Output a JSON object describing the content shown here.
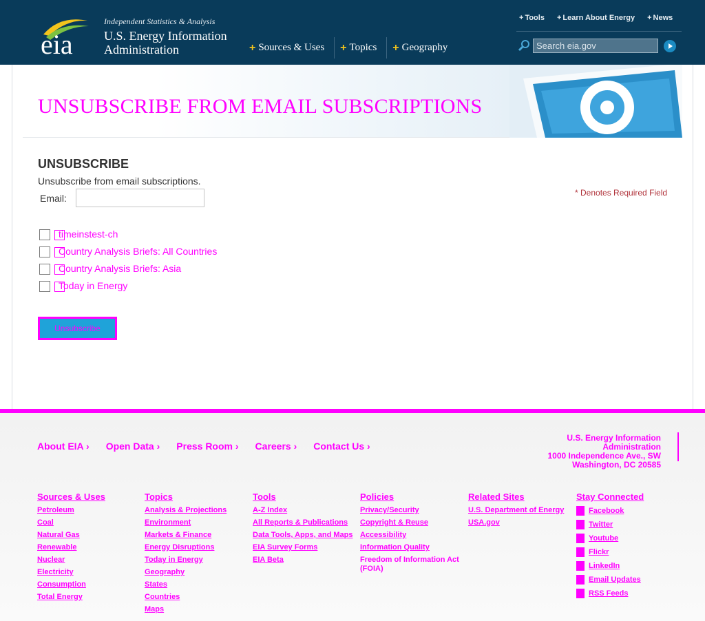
{
  "header": {
    "tagline": "Independent Statistics & Analysis",
    "site_name": "U.S. Energy Information Administration",
    "logo_text": "eia",
    "utility_links": [
      "Tools",
      "Learn About Energy",
      "News"
    ],
    "main_nav": [
      "Sources & Uses",
      "Topics",
      "Geography"
    ],
    "search_placeholder": "Search eia.gov"
  },
  "banner": {
    "title": "UNSUBSCRIBE FROM EMAIL SUBSCRIPTIONS"
  },
  "form": {
    "heading": "UNSUBSCRIBE",
    "description": "Unsubscribe from email subscriptions.",
    "required_note": "* Denotes Required Field",
    "email_label": "Email:",
    "email_value": "",
    "subscriptions": [
      {
        "label": "timeinstest-ch",
        "checked": false
      },
      {
        "label": "Country Analysis Briefs: All Countries",
        "checked": false
      },
      {
        "label": "Country Analysis Briefs: Asia",
        "checked": false
      },
      {
        "label": "Today in Energy",
        "checked": false
      }
    ],
    "submit_label": "Unsubscribe"
  },
  "footer": {
    "nav": [
      "About EIA",
      "Open Data",
      "Press Room",
      "Careers",
      "Contact Us"
    ],
    "address": [
      "U.S. Energy Information Administration",
      "1000 Independence Ave., SW",
      "Washington, DC 20585"
    ],
    "columns": [
      {
        "heading": "Sources & Uses",
        "links": [
          "Petroleum",
          "Coal",
          "Natural Gas",
          "Renewable",
          "Nuclear",
          "Electricity",
          "Consumption",
          "Total Energy"
        ]
      },
      {
        "heading": "Topics",
        "links": [
          "Analysis & Projections",
          "Environment",
          "Markets & Finance",
          "Energy Disruptions",
          "Today in Energy",
          "Geography",
          "States",
          "Countries",
          "Maps"
        ]
      },
      {
        "heading": "Tools",
        "links": [
          "A-Z Index",
          "All Reports & Publications",
          "Data Tools, Apps, and Maps",
          "EIA Survey Forms",
          "EIA Beta"
        ]
      },
      {
        "heading": "Policies",
        "links": [
          "Privacy/Security",
          "Copyright & Reuse",
          "Accessibility",
          "Information Quality",
          "Freedom of Information Act (FOIA)"
        ]
      },
      {
        "heading": "Related Sites",
        "links": [
          "U.S. Department of Energy",
          "USA.gov"
        ]
      },
      {
        "heading": "Stay Connected",
        "links": [
          "Facebook",
          "Twitter",
          "Youtube",
          "Flickr",
          "LinkedIn",
          "Email Updates",
          "RSS Feeds"
        ]
      }
    ]
  },
  "colors": {
    "header_bg": "#093b5a",
    "accent_yellow": "#f3c41c",
    "magenta_placeholder": "#ff00ff",
    "button_blue": "#1fa3d9",
    "required_red": "#b0323a"
  },
  "icons": {
    "search": "search-icon",
    "go": "arrow-right-icon",
    "plus": "plus-icon",
    "social": [
      "facebook-icon",
      "twitter-icon",
      "youtube-icon",
      "flickr-icon",
      "linkedin-icon",
      "email-icon",
      "rss-icon"
    ]
  }
}
